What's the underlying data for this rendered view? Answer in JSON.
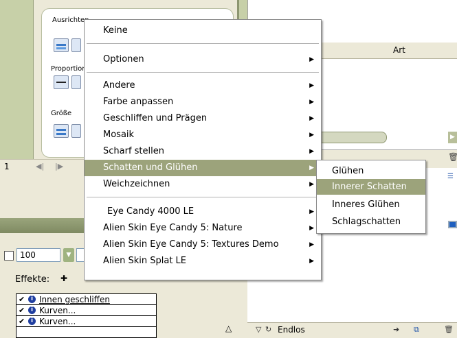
{
  "left_panel": {
    "align_label": "Ausrichten",
    "proportion_label": "Proportionen",
    "size_label": "Größe",
    "frame_number": "1"
  },
  "right_panel": {
    "column_header": "Art"
  },
  "opacity": {
    "value": "100"
  },
  "effects": {
    "label": "Effekte:",
    "items": [
      "Innen geschliffen",
      "Kurven...",
      "Kurven..."
    ]
  },
  "bottom_bar": {
    "loop_label": "Endlos"
  },
  "context_menu": {
    "items": [
      "Keine",
      "Optionen",
      "Andere",
      "Farbe anpassen",
      "Geschliffen und Prägen",
      "Mosaik",
      "Scharf stellen",
      "Schatten und Glühen",
      "Weichzeichnen",
      "Eye Candy 4000 LE",
      "Alien Skin Eye Candy 5: Nature",
      "Alien Skin Eye Candy 5: Textures Demo",
      "Alien Skin Splat LE"
    ],
    "highlighted": "Schatten und Glühen"
  },
  "submenu": {
    "items": [
      "Glühen",
      "Innerer Schatten",
      "Inneres Glühen",
      "Schlagschatten"
    ],
    "highlighted": "Innerer Schatten"
  },
  "colors": {
    "highlight": "#9ca37b",
    "panel": "#ECE9D8"
  },
  "icons": [
    "chevron-right-icon",
    "info-icon",
    "check-icon",
    "trash-icon",
    "loop-icon"
  ]
}
